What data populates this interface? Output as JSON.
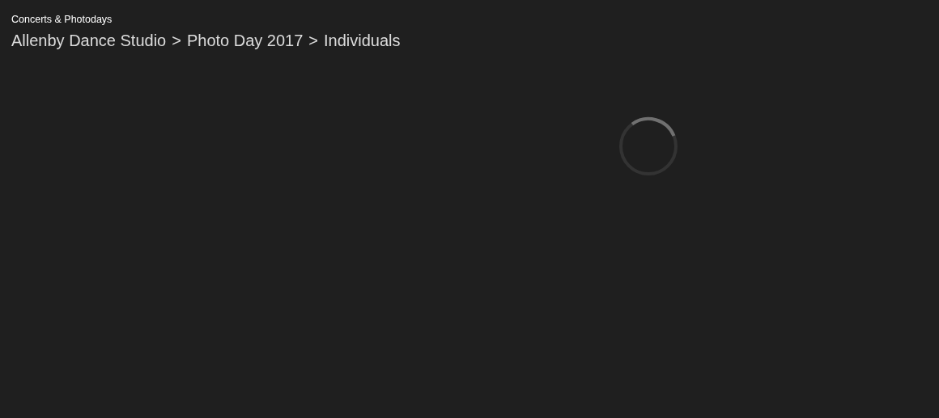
{
  "section_title": "Concerts & Photodays",
  "breadcrumb": {
    "separator": ">",
    "items": [
      "Allenby Dance Studio",
      "Photo Day 2017",
      "Individuals"
    ]
  },
  "loading": true
}
